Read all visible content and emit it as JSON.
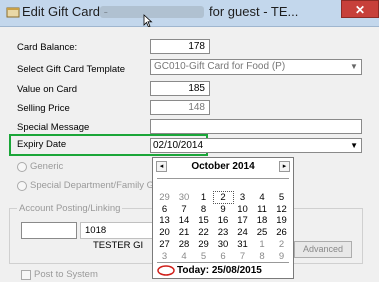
{
  "window": {
    "title": "Edit Gift Card -",
    "title_suffix": "for guest - TE...",
    "close_glyph": "✕"
  },
  "form": {
    "card_balance_label": "Card Balance:",
    "card_balance_value": "178",
    "template_label": "Select Gift Card Template",
    "template_value": "GC010-Gift Card for Food (P)",
    "value_on_card_label": "Value on Card",
    "value_on_card_value": "185",
    "selling_price_label": "Selling Price",
    "selling_price_value": "148",
    "special_message_label": "Special Message",
    "special_message_value": "",
    "expiry_date_label": "Expiry Date",
    "expiry_date_value": "02/10/2014",
    "generic_label": "Generic",
    "special_dept_label": "Special Department/Family Grou",
    "account_posting_label": "Account Posting/Linking",
    "account_code": "1018",
    "account_name": "TESTER GI",
    "advanced_button": "Advanced",
    "post_to_system_label": "Post to System"
  },
  "calendar": {
    "month_title": "October 2014",
    "prev_glyph": "◂",
    "next_glyph": "▸",
    "weeks": [
      [
        "29",
        "30",
        "1",
        "2",
        "3",
        "4",
        "5"
      ],
      [
        "6",
        "7",
        "8",
        "9",
        "10",
        "11",
        "12"
      ],
      [
        "13",
        "14",
        "15",
        "16",
        "17",
        "18",
        "19"
      ],
      [
        "20",
        "21",
        "22",
        "23",
        "24",
        "25",
        "26"
      ],
      [
        "27",
        "28",
        "29",
        "30",
        "31",
        "1",
        "2"
      ],
      [
        "3",
        "4",
        "5",
        "6",
        "7",
        "8",
        "9"
      ]
    ],
    "muted_cells": [
      [
        0,
        0
      ],
      [
        0,
        1
      ],
      [
        4,
        5
      ],
      [
        4,
        6
      ],
      [
        5,
        0
      ],
      [
        5,
        1
      ],
      [
        5,
        2
      ],
      [
        5,
        3
      ],
      [
        5,
        4
      ],
      [
        5,
        5
      ],
      [
        5,
        6
      ]
    ],
    "selected_cell": [
      0,
      3
    ],
    "today_text": "Today: 25/08/2015"
  },
  "colors": {
    "highlight": "#1ba639",
    "today_circle": "#d0201b"
  }
}
